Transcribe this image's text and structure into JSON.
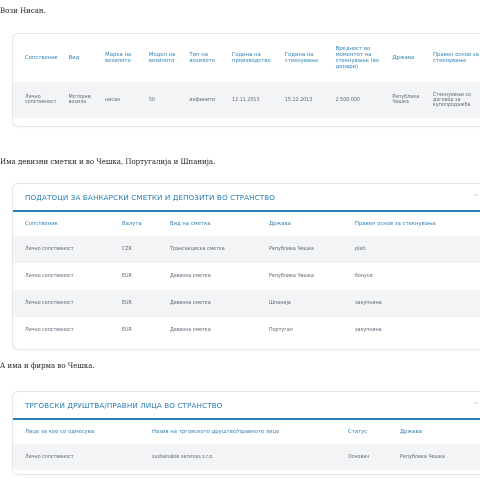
{
  "intro_vehicle": "Вози Нисан.",
  "vehicles": {
    "headers": [
      "Сопственик",
      "Вид",
      "Марка на возилото",
      "Модел на возилото",
      "Тип на возилото",
      "Година на производство",
      "Година на стекнување",
      "Вредност во моментот на стекнување (во денари)",
      "Држава",
      "Правен основ за стекнување"
    ],
    "rows": [
      [
        "Лично сопственост",
        "Моторни возила",
        "нисан",
        "50",
        "инфинити",
        "12.11.2013",
        "15.12.2013",
        "2.500.000",
        "Република Чешка",
        "Стекнување со договор за купопродажба"
      ]
    ]
  },
  "intro_bank": "Има девизни сметки и во Чешка, Португалија и Шпанија.",
  "bank": {
    "title": "ПОДАТОЦИ ЗА БАНКАРСКИ СМЕТКИ И ДЕПОЗИТИ ВО СТРАНСТВО",
    "headers": [
      "Сопственик",
      "Валута",
      "Вид на сметка",
      "Држава",
      "Правен основ за стекнување"
    ],
    "rows": [
      [
        "Лично сопственост",
        "CZK",
        "Трансакциска сметка",
        "Република Чешка",
        "plati"
      ],
      [
        "Лично сопственост",
        "EUR",
        "Девизна сметка",
        "Република Чешка",
        "бонуси"
      ],
      [
        "Лично сопственост",
        "EUR",
        "Девизна сметка",
        "Шпанија",
        "закупнина"
      ],
      [
        "Лично сопственост",
        "EUR",
        "Девизна сметка",
        "Португал",
        "закупнина"
      ]
    ]
  },
  "intro_company": "А има и фирма во Чешка.",
  "companies": {
    "title": "ТРГОВСКИ ДРУШТВА/ПРАВНИ ЛИЦА ВО СТРАНСТВО",
    "headers": [
      "Лице за кое се однесува",
      "Назив на трговското друштво/правното лице",
      "Статус",
      "Држава"
    ],
    "rows": [
      [
        "Лично сопственост",
        "sustainable services s.r.o.",
        "Основач",
        "Република Чешка"
      ]
    ]
  },
  "icons": {
    "collapse": "chevron-up-icon"
  },
  "colors": {
    "accent": "#2a7fb4",
    "row_stripe": "#f3f4f6"
  }
}
